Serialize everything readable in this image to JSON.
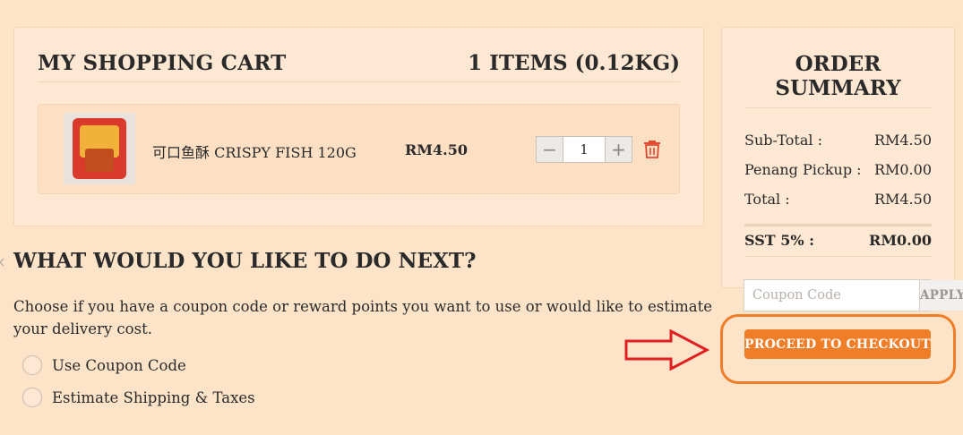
{
  "cart": {
    "title": "MY SHOPPING CART",
    "count_label": "1 ITEMS (0.12KG)",
    "items": [
      {
        "name": "可口鱼酥 CRISPY FISH 120G",
        "price": "RM4.50",
        "quantity": "1",
        "image_icon": "product-bag-thumbnail"
      }
    ],
    "qty_minus_icon": "minus-icon",
    "qty_plus_icon": "plus-icon",
    "delete_icon": "trash-icon"
  },
  "next_steps": {
    "title": "WHAT WOULD YOU LIKE TO DO NEXT?",
    "description": "Choose if you have a coupon code or reward points you want to use or would like to estimate your delivery cost.",
    "options": [
      {
        "label": "Use Coupon Code"
      },
      {
        "label": "Estimate Shipping & Taxes"
      }
    ]
  },
  "summary": {
    "title_line1": "ORDER",
    "title_line2": "SUMMARY",
    "rows": [
      {
        "label": "Sub-Total :",
        "value": "RM4.50"
      },
      {
        "label": "Penang Pickup :",
        "value": "RM0.00"
      },
      {
        "label": "Total :",
        "value": "RM4.50"
      }
    ],
    "sst": {
      "label": "SST 5% :",
      "value": "RM0.00"
    },
    "coupon_placeholder": "Coupon Code",
    "apply_label": "APPLY",
    "checkout_label": "PROCEED TO CHECKOUT"
  },
  "colors": {
    "accent": "#f07d28",
    "annotation_arrow": "#e02020",
    "background": "#fde3c8"
  }
}
